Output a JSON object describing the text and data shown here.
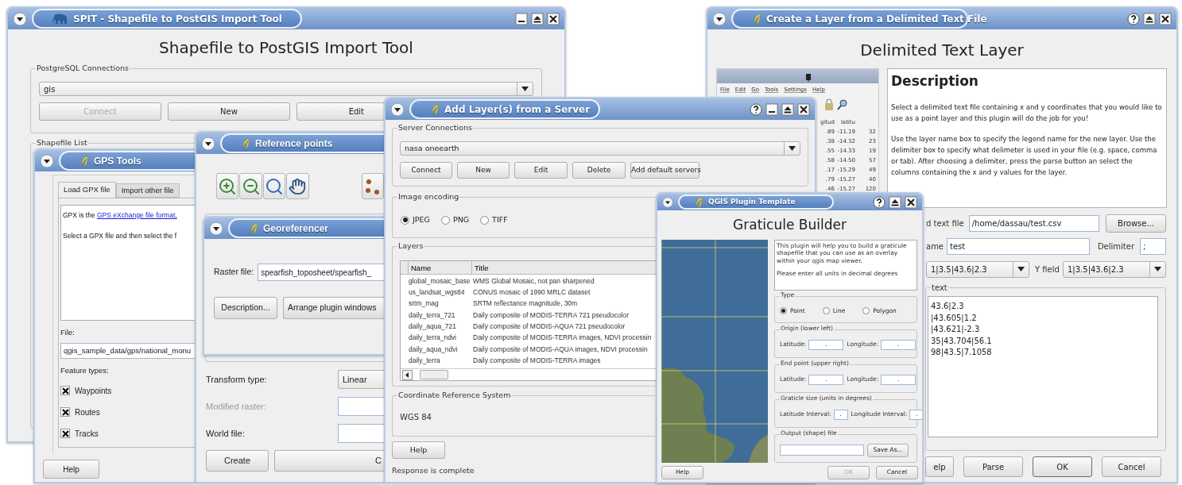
{
  "spit": {
    "title": "SPIT - Shapefile to PostGIS Import Tool",
    "heading": "Shapefile to PostGIS Import Tool",
    "connections_group": "PostgreSQL Connections",
    "connection": "gis",
    "buttons": [
      {
        "label": "Connect",
        "disabled": true
      },
      {
        "label": "New",
        "disabled": false
      },
      {
        "label": "Edit",
        "disabled": false
      }
    ],
    "shapefile_group": "Shapefile List"
  },
  "gps_tools": {
    "title": "GPS Tools",
    "tabs": [
      {
        "label": "Load GPX file",
        "selected": true
      },
      {
        "label": "Import other file",
        "selected": false
      }
    ],
    "info_prefix": "GPX is the ",
    "info_link": "GPS eXchange file format,",
    "info_line2": "Select a GPX file and then select the f",
    "file_label": "File:",
    "file_value": "qgis_sample_data/gps/national_monu",
    "feature_label": "Feature types:",
    "features": [
      {
        "label": "Waypoints",
        "checked": true
      },
      {
        "label": "Routes",
        "checked": true
      },
      {
        "label": "Tracks",
        "checked": true
      }
    ],
    "help": "Help"
  },
  "reference_points": {
    "title": "Reference points",
    "transform_label": "Transform type:",
    "transform_value": "Linear",
    "modified_label": "Modified raster:",
    "modified_disabled": true,
    "world_label": "World file:",
    "buttons": [
      "Create",
      "C"
    ]
  },
  "georeferencer": {
    "title": "Georeferencer",
    "raster_label": "Raster file:",
    "raster_value": "spearfish_toposheet/spearfish_",
    "buttons": [
      "Description...",
      "Arrange plugin windows"
    ]
  },
  "delimited_text": {
    "title": "Create a Layer from a Delimited Text File",
    "heading": "Delimited Text Layer",
    "screenshot": {
      "menu": [
        "File",
        "Edit",
        "Go",
        "Tools",
        "Settings",
        "Help"
      ],
      "columns": [
        {
          "header": "gitud",
          "values": [
            ".89",
            ".38",
            ".55",
            ".58",
            ".17",
            ".79",
            ".46"
          ]
        },
        {
          "header": "latitu",
          "values": [
            "-11.19",
            "-14.32",
            "-14.33",
            "-14.50",
            "-15.29",
            "-15.27",
            "-15.27"
          ]
        },
        {
          "values": [
            "32",
            "23",
            "19",
            "57",
            "49",
            "40",
            "120"
          ]
        }
      ]
    },
    "description_title": "Description",
    "description": [
      "Select a delimited text file containing x and y coordinates that you would like to use as a point layer and this plugin will do the job for you!",
      "Use the layer name box to specify the legend name for the new layer. Use the delimiter box to specify what delimeter is used in your file (e.g. space, comma or tab). After choosing a delimiter, press the parse button an select the columns containing the x and y values for the layer."
    ],
    "file_label": "d text file",
    "file_value": "/home/dassau/test.csv",
    "browse": "Browse...",
    "name_label": "ame",
    "name_value": "test",
    "delimiter_label": "Delimiter",
    "delimiter_value": ";",
    "x_value": "1|3.5|43.6|2.3",
    "y_label": "Y field",
    "y_value": "1|3.5|43.6|2.3",
    "sample_group": "text",
    "sample_lines": [
      "43.6|2.3",
      "|43.605|1.2",
      "|43.621|-2.3",
      "35|43.704|56.1",
      "98|43.5|7.1058"
    ],
    "buttons": [
      "elp",
      "Parse",
      "OK",
      "Cancel"
    ]
  },
  "add_layer": {
    "title": "Add Layer(s) from a Server",
    "server_group": "Server Connections",
    "server": "nasa oneearth",
    "buttons": [
      "Connect",
      "New",
      "Edit",
      "Delete",
      "Add default servers"
    ],
    "encoding_group": "Image encoding",
    "encodings": [
      {
        "label": "JPEG",
        "selected": true
      },
      {
        "label": "PNG",
        "selected": false
      },
      {
        "label": "TIFF",
        "selected": false
      }
    ],
    "layers_group": "Layers",
    "columns": [
      "Name",
      "Title"
    ],
    "rows": [
      {
        "name": "global_mosaic_base",
        "title": "WMS Global Mosaic, not pan sharpened"
      },
      {
        "name": "us_landsat_wgs84",
        "title": "CONUS mosaic of 1990 MRLC dataset"
      },
      {
        "name": "srtm_mag",
        "title": "SRTM reflectance magnitude, 30m"
      },
      {
        "name": "daily_terra_721",
        "title": "Daily composite of MODIS-TERRA 721 pseudocolor"
      },
      {
        "name": "daily_aqua_721",
        "title": "Daily composite of MODIS-AQUA 721 pseudocolor"
      },
      {
        "name": "daily_terra_ndvi",
        "title": "Daily composite of MODIS-TERRA images, NDVI processin"
      },
      {
        "name": "daily_aqua_ndvi",
        "title": "Daily composite of MODIS-AQUA images, NDVI processin"
      },
      {
        "name": "daily_terra",
        "title": "Daily composite of MODIS-TERRA images"
      }
    ],
    "crs_group": "Coordinate Reference System",
    "crs": "WGS 84",
    "help": "Help",
    "status": "Response is complete"
  },
  "graticule": {
    "title": "QGIS Plugin Template",
    "heading": "Graticule Builder",
    "description": [
      "This plugin will help you to build a graticule shapefile that you can use as an overlay within your qgis map viewer.",
      "Please enter all units in decimal degrees"
    ],
    "type_group": "Type",
    "types": [
      {
        "label": "Point",
        "selected": true
      },
      {
        "label": "Line",
        "selected": false
      },
      {
        "label": "Polygon",
        "selected": false
      }
    ],
    "field_groups": [
      {
        "title": "Origin (lower left)",
        "fields": [
          {
            "label": "Latitude:",
            "value": "."
          },
          {
            "label": "Longitude:",
            "value": "."
          }
        ]
      },
      {
        "title": "End point (upper right)",
        "fields": [
          {
            "label": "Latitude:",
            "value": "."
          },
          {
            "label": "Longitude:",
            "value": "."
          }
        ]
      },
      {
        "title": "Graticle size (units in degrees)",
        "fields": [
          {
            "label": "Latitude Interval:",
            "value": "."
          },
          {
            "label": "Longitude Interval:",
            "value": "."
          }
        ]
      }
    ],
    "output_group": "Output (shape) file",
    "save_as": "Save As...",
    "buttons": [
      {
        "label": "Help",
        "disabled": false
      },
      {
        "label": "OK",
        "disabled": true
      },
      {
        "label": "Cancel",
        "disabled": false
      }
    ]
  }
}
